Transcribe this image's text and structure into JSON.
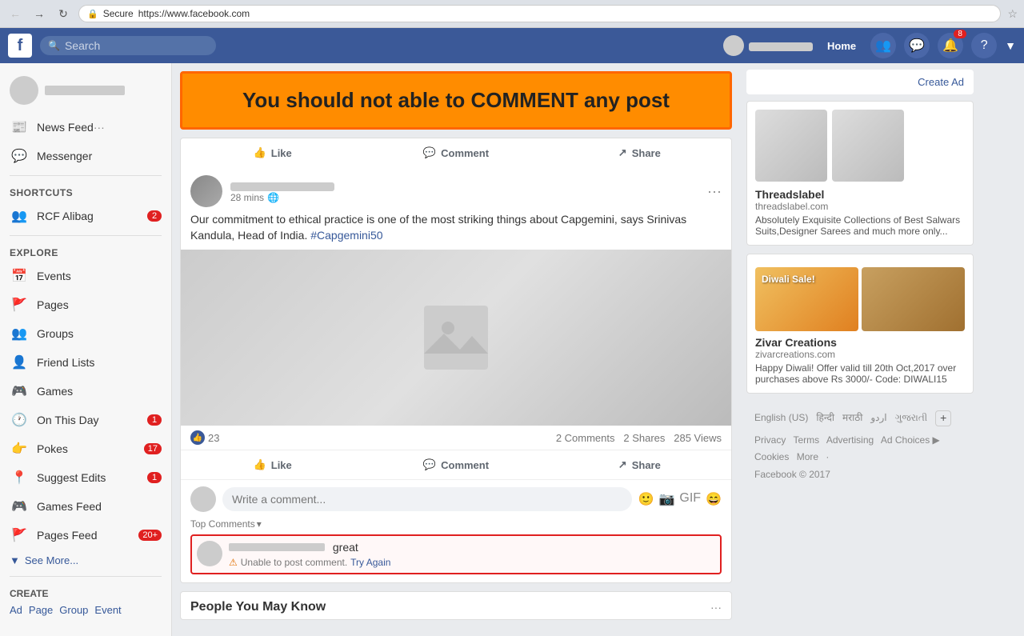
{
  "browser": {
    "url": "https://www.facebook.com",
    "url_display": "https://www.facebook.com",
    "secure_label": "Secure"
  },
  "header": {
    "logo": "f",
    "search_placeholder": "Search",
    "home_label": "Home",
    "friends_icon": "👥",
    "messenger_icon": "💬",
    "notifications_icon": "🔔",
    "notifications_count": "8",
    "help_icon": "?",
    "dropdown_icon": "▼"
  },
  "banner": {
    "text": "You should not able to COMMENT any post"
  },
  "sidebar": {
    "news_feed_label": "News Feed",
    "messenger_label": "Messenger",
    "shortcuts_label": "Shortcuts",
    "rcf_alibag_label": "RCF Alibag",
    "rcf_alibag_count": "2",
    "explore_label": "Explore",
    "items": [
      {
        "id": "events",
        "label": "Events",
        "icon": "📅",
        "badge": ""
      },
      {
        "id": "pages",
        "label": "Pages",
        "icon": "🚩",
        "badge": ""
      },
      {
        "id": "groups",
        "label": "Groups",
        "icon": "👥",
        "badge": ""
      },
      {
        "id": "friend-lists",
        "label": "Friend Lists",
        "icon": "👤",
        "badge": ""
      },
      {
        "id": "games",
        "label": "Games",
        "icon": "🎮",
        "badge": ""
      },
      {
        "id": "on-this-day",
        "label": "On This Day",
        "icon": "🕐",
        "badge": "1"
      },
      {
        "id": "pokes",
        "label": "Pokes",
        "icon": "👉",
        "badge": "17"
      },
      {
        "id": "suggest-edits",
        "label": "Suggest Edits",
        "icon": "📍",
        "badge": "1"
      },
      {
        "id": "games-feed",
        "label": "Games Feed",
        "icon": "🎮",
        "badge": ""
      },
      {
        "id": "pages-feed",
        "label": "Pages Feed",
        "icon": "🚩",
        "badge": "20+"
      }
    ],
    "see_more_label": "See More...",
    "create_label": "Create",
    "create_links": [
      "Ad",
      "Page",
      "Group",
      "Event"
    ]
  },
  "create_ad": {
    "label": "Create Ad"
  },
  "post": {
    "author_time": "28 mins",
    "globe_icon": "🌐",
    "more_icon": "···",
    "content": "Our commitment to ethical practice is one of the most striking things about Capgemini, says Srinivas Kandula, Head of India.",
    "hashtag": "#Capgemini50",
    "likes_count": "23",
    "comments_count": "2 Comments",
    "shares_count": "2 Shares",
    "views_count": "285 Views",
    "like_label": "Like",
    "comment_label": "Comment",
    "share_label": "Share",
    "write_comment_placeholder": "Write a comment...",
    "top_comments_label": "Top Comments",
    "comment_text": "great",
    "comment_error": "Unable to post comment.",
    "try_again_label": "Try Again"
  },
  "pymk": {
    "title": "People You May Know",
    "more_icon": "···"
  },
  "ads": {
    "ad1": {
      "title": "Threadslabel",
      "url": "threadslabel.com",
      "description": "Absolutely Exquisite Collections of Best Salwars Suits,Designer Sarees and much more only..."
    },
    "ad2": {
      "title": "Zivar Creations",
      "url": "zivarcreations.com",
      "description": "Happy Diwali! Offer valid till 20th Oct,2017 over purchases above Rs 3000/- Code: DIWALI15"
    }
  },
  "footer": {
    "languages": [
      "English (US)",
      "हिन्दी",
      "मराठी",
      "اردو",
      "ગુજરાતી"
    ],
    "links": [
      "Privacy",
      "Terms",
      "Advertising",
      "Ad Choices",
      "Cookies",
      "More",
      "Facebook © 2017"
    ],
    "more_label": "More"
  }
}
